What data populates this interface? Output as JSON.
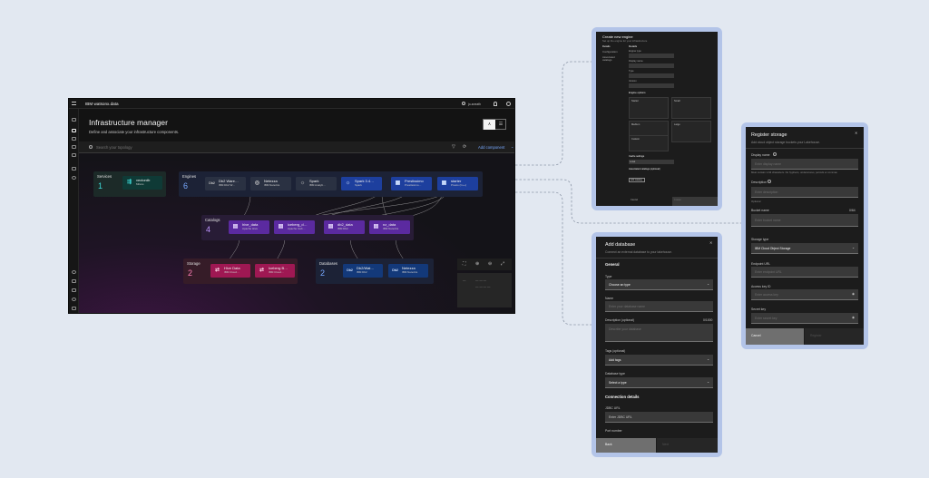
{
  "app": {
    "brand": "IBM watsonx.data",
    "user": "jo-sneath",
    "title": "Infrastructure manager",
    "subtitle": "Define and associate your infrastructure components.",
    "search_placeholder": "Search your topology",
    "add_component": "Add component",
    "groups": {
      "services": {
        "title": "Services",
        "count": "1"
      },
      "engines": {
        "title": "Engines",
        "count": "6"
      },
      "catalogs": {
        "title": "Catalogs",
        "count": "4"
      },
      "storage": {
        "title": "Storage",
        "count": "2"
      },
      "databases": {
        "title": "Databases",
        "count": "2"
      }
    },
    "nodes": {
      "milvus": {
        "title": "vectordb",
        "sub": "Milvus",
        "icon": "⇶"
      },
      "db2": {
        "title": "Db2 Ware…",
        "sub": "IBM Db2 W…",
        "icon": "Db2"
      },
      "netezza": {
        "title": "Netezza",
        "sub": "IBM Netezza",
        "icon": "◎"
      },
      "spark": {
        "title": "Spark",
        "sub": "IBM Analyti…",
        "icon": "☼"
      },
      "spark3": {
        "title": "Spark 3.4…",
        "sub": "Spark",
        "icon": "☼"
      },
      "presto_eng": {
        "title": "Prestissimo",
        "sub": "Prestissimo…",
        "icon": "▦"
      },
      "presto_c": {
        "title": "starter",
        "sub": "Presto (C++)",
        "icon": "▦"
      },
      "hive_data": {
        "title": "hive_data",
        "sub": "Apache Hive",
        "icon": "▤"
      },
      "iceberg": {
        "title": "iceberg_d…",
        "sub": "Apache Iceb…",
        "icon": "▤"
      },
      "db2_data": {
        "title": "db2_data",
        "sub": "IBM Db2",
        "icon": "▤"
      },
      "nz_data": {
        "title": "nz_data",
        "sub": "IBM Netezza",
        "icon": "▤"
      },
      "hive_stor": {
        "title": "Hive Data",
        "sub": "IBM Cloud…",
        "icon": "⇄"
      },
      "iceberg_stor": {
        "title": "Iceberg B…",
        "sub": "IBM Cloud…",
        "icon": "⇄"
      },
      "db2_db": {
        "title": "Db2/Wat…",
        "sub": "IBM Db2",
        "icon": "Db2"
      },
      "netezza_db": {
        "title": "Netezza",
        "sub": "IBM Netezza",
        "icon": "Db2"
      }
    },
    "minimap_legend": [
      "—",
      "— — —",
      "— — — —"
    ]
  },
  "engine_panel": {
    "title": "Create new engine",
    "subtitle": "Set up the engine for your infrastructure",
    "nav": [
      "Details",
      "Configuration",
      "Associated catalogs"
    ],
    "section": "Details",
    "labels": [
      "Engine type",
      "Display name",
      "Type",
      "Version"
    ],
    "options_heading": "Engine options",
    "tiles": [
      "Starter",
      "Small",
      "Medium",
      "Large",
      "Custom"
    ],
    "cache_heading": "Cache settings",
    "cache_value": "Local",
    "assoc_heading": "Associated catalogs (optional)",
    "assoc_button": "Add catalog",
    "cancel": "Cancel",
    "create": "Create"
  },
  "database_panel": {
    "title": "Add database",
    "subtitle": "Connect an external database to your lakehouse.",
    "section": "General",
    "type_label": "Type",
    "type_value": "Choose an type",
    "name_label": "Name",
    "name_placeholder": "Enter your database name",
    "desc_label": "Description (optional)",
    "desc_count": "0/1000",
    "desc_placeholder": "Describe your database",
    "tags_label": "Tags (optional)",
    "tags_value": "Add tags",
    "dbtype_label": "Database type",
    "dbtype_value": "Select a type",
    "conn_heading": "Connection details",
    "jdbc_label": "JDBC URL",
    "jdbc_value": "Enter JDBC URL",
    "port_label": "Port number",
    "back": "Back",
    "next": "Next"
  },
  "storage_panel": {
    "title": "Register storage",
    "subtitle": "Add cloud object storage buckets your Lakehouse.",
    "display_label": "Display name",
    "display_placeholder": "Enter display name",
    "display_helper": "Must contain 1-64 characters. No hyphens, underscores, periods or commas",
    "desc_label": "Description",
    "desc_placeholder": "Enter description",
    "desc_helper": "Optional",
    "bucket_label": "Bucket name",
    "bucket_count": "0/64",
    "bucket_placeholder": "Enter bucket name",
    "stype_label": "Storage type",
    "stype_value": "IBM Cloud Object Storage",
    "endpoint_label": "Endpoint URL",
    "endpoint_placeholder": "Enter endpoint URL",
    "access_label": "Access key ID",
    "access_placeholder": "Enter access key",
    "secret_label": "Secret key",
    "secret_placeholder": "Enter secret key",
    "cancel": "Cancel",
    "register": "Register"
  }
}
